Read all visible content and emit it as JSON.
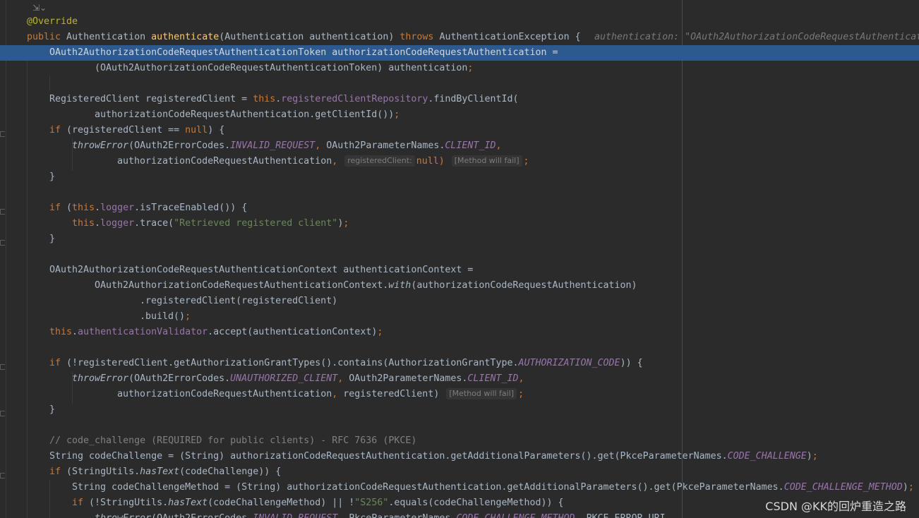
{
  "editor": {
    "annotation": "@Override",
    "lines": [
      {
        "id": "l2",
        "parts": [
          [
            "kw",
            "public "
          ],
          [
            "",
            "Authentication "
          ],
          [
            "fn",
            "authenticate"
          ],
          [
            "",
            "(Authentication authentication) "
          ],
          [
            "kw",
            "throws "
          ],
          [
            "",
            "AuthenticationException {"
          ]
        ]
      },
      {
        "id": "l3",
        "parts": [
          [
            "sel-text",
            "OAuth2AuthorizationCodeRequestAuthenticationToken authorizationCodeRequestAuthentication ="
          ]
        ]
      },
      {
        "id": "l4",
        "parts": [
          [
            "",
            "(OAuth2AuthorizationCodeRequestAuthenticationToken) authentication"
          ],
          [
            "kw",
            ";"
          ]
        ]
      },
      {
        "id": "l6",
        "parts": [
          [
            "",
            "RegisteredClient registeredClient = "
          ],
          [
            "kw",
            "this"
          ],
          [
            "",
            "."
          ],
          [
            "fld",
            "registeredClientRepository"
          ],
          [
            "",
            ".findByClientId("
          ]
        ]
      },
      {
        "id": "l7",
        "parts": [
          [
            "",
            "authorizationCodeRequestAuthentication.getClientId())"
          ],
          [
            "kw",
            ";"
          ]
        ]
      },
      {
        "id": "l8",
        "parts": [
          [
            "kw",
            "if "
          ],
          [
            "",
            "(registeredClient == "
          ],
          [
            "kw",
            "null"
          ],
          [
            "",
            ") {"
          ]
        ]
      },
      {
        "id": "l9",
        "parts": [
          [
            "sm",
            "throwError"
          ],
          [
            "",
            "(OAuth2ErrorCodes."
          ],
          [
            "cst",
            "INVALID_REQUEST"
          ],
          [
            "kw",
            ", "
          ],
          [
            "",
            "OAuth2ParameterNames."
          ],
          [
            "cst",
            "CLIENT_ID"
          ],
          [
            "kw",
            ","
          ]
        ]
      },
      {
        "id": "l10",
        "parts": [
          [
            "",
            "authorizationCodeRequestAuthentication"
          ],
          [
            "kw",
            ", "
          ]
        ]
      },
      {
        "id": "l11",
        "parts": [
          [
            "",
            "}"
          ]
        ]
      },
      {
        "id": "l13",
        "parts": [
          [
            "kw",
            "if "
          ],
          [
            "",
            "("
          ],
          [
            "kw",
            "this"
          ],
          [
            "",
            "."
          ],
          [
            "fld",
            "logger"
          ],
          [
            "",
            ".isTraceEnabled()) {"
          ]
        ]
      },
      {
        "id": "l14",
        "parts": [
          [
            "kw",
            "this"
          ],
          [
            "",
            "."
          ],
          [
            "fld",
            "logger"
          ],
          [
            "",
            ".trace("
          ],
          [
            "str",
            "\"Retrieved registered client\""
          ],
          [
            "",
            ")"
          ],
          [
            "kw",
            ";"
          ]
        ]
      },
      {
        "id": "l15",
        "parts": [
          [
            "",
            "}"
          ]
        ]
      },
      {
        "id": "l17",
        "parts": [
          [
            "",
            "OAuth2AuthorizationCodeRequestAuthenticationContext authenticationContext ="
          ]
        ]
      },
      {
        "id": "l18",
        "parts": [
          [
            "",
            "OAuth2AuthorizationCodeRequestAuthenticationContext."
          ],
          [
            "sm",
            "with"
          ],
          [
            "",
            "(authorizationCodeRequestAuthentication)"
          ]
        ]
      },
      {
        "id": "l19",
        "parts": [
          [
            "",
            ".registeredClient(registeredClient)"
          ]
        ]
      },
      {
        "id": "l20",
        "parts": [
          [
            "",
            ".build()"
          ],
          [
            "kw",
            ";"
          ]
        ]
      },
      {
        "id": "l21",
        "parts": [
          [
            "kw",
            "this"
          ],
          [
            "",
            "."
          ],
          [
            "fld",
            "authenticationValidator"
          ],
          [
            "",
            ".accept(authenticationContext)"
          ],
          [
            "kw",
            ";"
          ]
        ]
      },
      {
        "id": "l23",
        "parts": [
          [
            "kw",
            "if "
          ],
          [
            "",
            "(!registeredClient.getAuthorizationGrantTypes().contains(AuthorizationGrantType."
          ],
          [
            "cst",
            "AUTHORIZATION_CODE"
          ],
          [
            "",
            ")) {"
          ]
        ]
      },
      {
        "id": "l24",
        "parts": [
          [
            "sm",
            "throwError"
          ],
          [
            "",
            "(OAuth2ErrorCodes."
          ],
          [
            "cst",
            "UNAUTHORIZED_CLIENT"
          ],
          [
            "kw",
            ", "
          ],
          [
            "",
            "OAuth2ParameterNames."
          ],
          [
            "cst",
            "CLIENT_ID"
          ],
          [
            "kw",
            ","
          ]
        ]
      },
      {
        "id": "l25",
        "parts": [
          [
            "",
            "authorizationCodeRequestAuthentication"
          ],
          [
            "kw",
            ", "
          ],
          [
            "",
            "registeredClient)"
          ]
        ]
      },
      {
        "id": "l26",
        "parts": [
          [
            "",
            "}"
          ]
        ]
      },
      {
        "id": "l28",
        "parts": [
          [
            "cmt",
            "// code_challenge (REQUIRED for public clients) - RFC 7636 (PKCE)"
          ]
        ]
      },
      {
        "id": "l29",
        "parts": [
          [
            "",
            "String codeChallenge = (String) authorizationCodeRequestAuthentication.getAdditionalParameters().get(PkceParameterNames."
          ],
          [
            "cst",
            "CODE_CHALLENGE"
          ],
          [
            "",
            ")"
          ],
          [
            "kw",
            ";"
          ]
        ]
      },
      {
        "id": "l30",
        "parts": [
          [
            "kw",
            "if "
          ],
          [
            "",
            "(StringUtils."
          ],
          [
            "sm",
            "hasText"
          ],
          [
            "",
            "(codeChallenge)) {"
          ]
        ]
      },
      {
        "id": "l31",
        "parts": [
          [
            "",
            "String codeChallengeMethod = (String) authorizationCodeRequestAuthentication.getAdditionalParameters().get(PkceParameterNames."
          ],
          [
            "cst",
            "CODE_CHALLENGE_METHOD"
          ],
          [
            "",
            ")"
          ],
          [
            "kw",
            ";"
          ]
        ]
      },
      {
        "id": "l32",
        "parts": [
          [
            "kw",
            "if "
          ],
          [
            "",
            "(!StringUtils."
          ],
          [
            "sm",
            "hasText"
          ],
          [
            "",
            "(codeChallengeMethod) || !"
          ],
          [
            "str",
            "\"S256\""
          ],
          [
            "",
            ".equals(codeChallengeMethod)) {"
          ]
        ]
      },
      {
        "id": "l33",
        "parts": [
          [
            "sm",
            "throwError"
          ],
          [
            "",
            "(OAuth2ErrorCodes."
          ],
          [
            "cst",
            "INVALID_REQUEST"
          ],
          [
            "kw",
            ", "
          ],
          [
            "",
            "PkceParameterNames."
          ],
          [
            "cst",
            "CODE_CHALLENGE_METHOD"
          ],
          [
            "kw",
            ", "
          ],
          [
            "",
            "PKCE_ERROR_URI"
          ]
        ]
      }
    ],
    "inline_debug_value": "authentication: \"OAuth2AuthorizationCodeRequestAuthenticat",
    "hint_registered_client": "registeredClient:",
    "hint_null": "null)",
    "hint_method_fail": "[Method will fail]",
    "hint_semicolon": ";"
  },
  "watermark": "CSDN @KK的回炉重造之路",
  "colors": {
    "background": "#2b2b2b",
    "selection": "#2d5a8e",
    "keyword": "#cc7832",
    "method": "#ffc66d",
    "field": "#9876aa",
    "string": "#6a8759",
    "comment": "#808080",
    "annotation": "#bbb529",
    "text": "#a9b7c6"
  }
}
